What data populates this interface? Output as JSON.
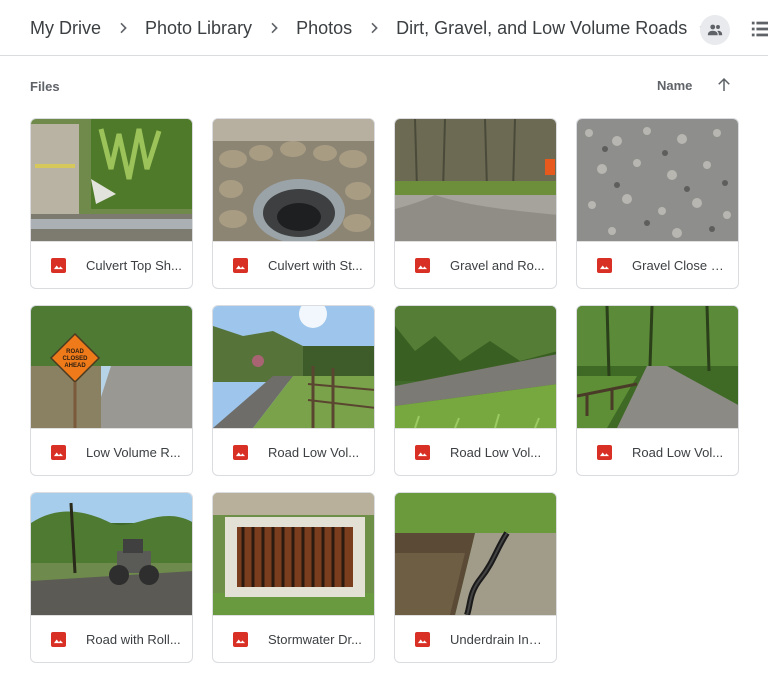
{
  "breadcrumb": {
    "items": [
      "My Drive",
      "Photo Library",
      "Photos",
      "Dirt, Gravel, and Low Volume Roads"
    ]
  },
  "section": {
    "title": "Files"
  },
  "sort": {
    "label": "Name",
    "direction": "ascending"
  },
  "files": [
    {
      "name": "Culvert Top Sh...",
      "scene": "culvert-top"
    },
    {
      "name": "Culvert with St...",
      "scene": "culvert-stone"
    },
    {
      "name": "Gravel and Ro...",
      "scene": "gravel-road"
    },
    {
      "name": "Gravel Close U...",
      "scene": "gravel-close"
    },
    {
      "name": "Low Volume R...",
      "scene": "road-closed"
    },
    {
      "name": "Road Low Vol...",
      "scene": "road-fence"
    },
    {
      "name": "Road Low Vol...",
      "scene": "road-green"
    },
    {
      "name": "Road Low Vol...",
      "scene": "road-forest"
    },
    {
      "name": "Road with Roll...",
      "scene": "roller"
    },
    {
      "name": "Stormwater Dr...",
      "scene": "drain"
    },
    {
      "name": "Underdrain Ins...",
      "scene": "underdrain"
    }
  ],
  "colors": {
    "file_icon": "#d93025",
    "border": "#dadce0",
    "text": "#3c4043"
  },
  "icons": {
    "separator": "chevron-right-icon",
    "dropdown": "caret-down-icon",
    "share": "people-icon",
    "view": "list-view-icon",
    "sort": "arrow-up-icon",
    "file": "image-file-icon"
  }
}
